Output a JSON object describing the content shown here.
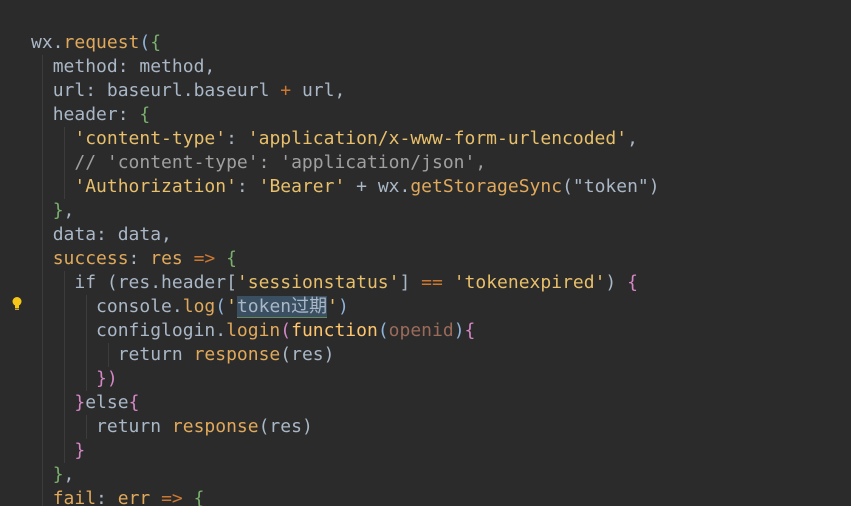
{
  "editor": {
    "theme": "dark",
    "bulb_color": "#f5c518",
    "lines": [
      {
        "indent": 0,
        "segments": [
          {
            "cls": "ident",
            "text": "wx."
          },
          {
            "cls": "call",
            "text": "request"
          },
          {
            "cls": "paren",
            "text": "("
          },
          {
            "cls": "brace1",
            "text": "{"
          }
        ]
      },
      {
        "indent": 1,
        "segments": [
          {
            "cls": "ident",
            "text": "method: method,"
          }
        ]
      },
      {
        "indent": 1,
        "segments": [
          {
            "cls": "ident",
            "text": "url: baseurl.baseurl "
          },
          {
            "cls": "kw",
            "text": "+"
          },
          {
            "cls": "ident",
            "text": " url,"
          }
        ]
      },
      {
        "indent": 1,
        "segments": [
          {
            "cls": "ident",
            "text": "header: "
          },
          {
            "cls": "brace1",
            "text": "{"
          }
        ]
      },
      {
        "indent": 2,
        "segments": [
          {
            "cls": "str",
            "text": "'content-type'"
          },
          {
            "cls": "ident",
            "text": ": "
          },
          {
            "cls": "str",
            "text": "'application/x-www-form-urlencoded'"
          },
          {
            "cls": "ident",
            "text": ","
          }
        ]
      },
      {
        "indent": 2,
        "segments": [
          {
            "cls": "cmt",
            "text": "// 'content-type': 'application/json',"
          }
        ]
      },
      {
        "indent": 2,
        "segments": [
          {
            "cls": "str",
            "text": "'Authorization'"
          },
          {
            "cls": "ident",
            "text": ": "
          },
          {
            "cls": "str",
            "text": "'Bearer'"
          },
          {
            "cls": "ident",
            "text": " + wx."
          },
          {
            "cls": "call",
            "text": "getStorageSync"
          },
          {
            "cls": "ident",
            "text": "(\"token\")"
          }
        ]
      },
      {
        "indent": 1,
        "segments": [
          {
            "cls": "brace1",
            "text": "}"
          },
          {
            "cls": "ident",
            "text": ","
          }
        ]
      },
      {
        "indent": 1,
        "segments": [
          {
            "cls": "ident",
            "text": "data: data,"
          }
        ]
      },
      {
        "indent": 1,
        "segments": [
          {
            "cls": "call",
            "text": "success"
          },
          {
            "cls": "ident",
            "text": ": "
          },
          {
            "cls": "call",
            "text": "res"
          },
          {
            "cls": "kw",
            "text": " => "
          },
          {
            "cls": "brace1",
            "text": "{"
          }
        ]
      },
      {
        "indent": 2,
        "segments": [
          {
            "cls": "ident",
            "text": "if (res.header["
          },
          {
            "cls": "str",
            "text": "'sessionstatus'"
          },
          {
            "cls": "ident",
            "text": "] "
          },
          {
            "cls": "kw",
            "text": "=="
          },
          {
            "cls": "ident",
            "text": " "
          },
          {
            "cls": "str",
            "text": "'tokenexpired'"
          },
          {
            "cls": "ident",
            "text": ") "
          },
          {
            "cls": "brace2",
            "text": "{"
          }
        ]
      },
      {
        "indent": 3,
        "segments": [
          {
            "cls": "ident",
            "text": "console."
          },
          {
            "cls": "call",
            "text": "log"
          },
          {
            "cls": "paren",
            "text": "("
          },
          {
            "cls": "str",
            "text": "'"
          },
          {
            "cls": "sel",
            "text": "token过期"
          },
          {
            "cls": "str",
            "text": "'"
          },
          {
            "cls": "paren",
            "text": ")"
          }
        ]
      },
      {
        "indent": 3,
        "segments": [
          {
            "cls": "ident",
            "text": "configlogin."
          },
          {
            "cls": "call",
            "text": "login"
          },
          {
            "cls": "brace2",
            "text": "("
          },
          {
            "cls": "fn",
            "text": "function"
          },
          {
            "cls": "paren",
            "text": "("
          },
          {
            "cls": "param",
            "text": "openid"
          },
          {
            "cls": "paren",
            "text": ")"
          },
          {
            "cls": "brace2",
            "text": "{"
          }
        ]
      },
      {
        "indent": 4,
        "segments": [
          {
            "cls": "ident",
            "text": "return "
          },
          {
            "cls": "call",
            "text": "response"
          },
          {
            "cls": "ident",
            "text": "(res)"
          }
        ]
      },
      {
        "indent": 3,
        "segments": [
          {
            "cls": "brace2",
            "text": "})"
          }
        ]
      },
      {
        "indent": 2,
        "segments": [
          {
            "cls": "brace2",
            "text": "}"
          },
          {
            "cls": "ident",
            "text": "else"
          },
          {
            "cls": "brace2",
            "text": "{"
          }
        ]
      },
      {
        "indent": 3,
        "segments": [
          {
            "cls": "ident",
            "text": "return "
          },
          {
            "cls": "call",
            "text": "response"
          },
          {
            "cls": "ident",
            "text": "(res)"
          }
        ]
      },
      {
        "indent": 2,
        "segments": [
          {
            "cls": "brace2",
            "text": "}"
          }
        ]
      },
      {
        "indent": 1,
        "segments": [
          {
            "cls": "brace1",
            "text": "}"
          },
          {
            "cls": "ident",
            "text": ","
          }
        ]
      },
      {
        "indent": 1,
        "segments": [
          {
            "cls": "call",
            "text": "fail"
          },
          {
            "cls": "ident",
            "text": ": "
          },
          {
            "cls": "call",
            "text": "err"
          },
          {
            "cls": "kw",
            "text": " => "
          },
          {
            "cls": "brace1",
            "text": "{"
          }
        ]
      }
    ]
  }
}
